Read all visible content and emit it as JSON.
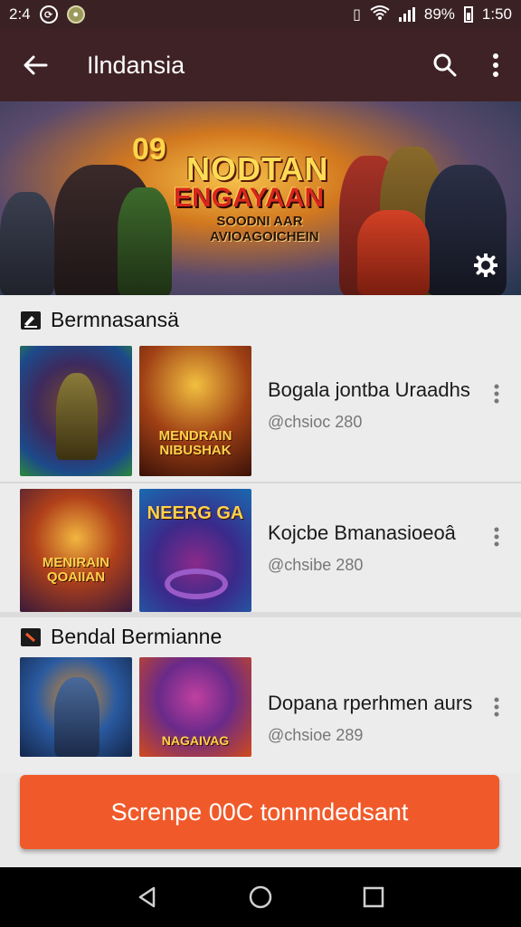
{
  "status": {
    "time_left": "2:4",
    "battery": "89%",
    "clock": "1:50"
  },
  "appbar": {
    "title": "Ilndansia"
  },
  "banner": {
    "number": "09",
    "logo_line1": "NODTAN",
    "logo_line2": "ENGAYAAN",
    "logo_line3": "SOODNI AAR AVIOAGOICHEIN"
  },
  "section1": {
    "title": "Bermnasansä"
  },
  "items1": [
    {
      "name": "Bogala jontba Uraadhs",
      "meta": "@chsioc 280",
      "thumb_text2": "MENDRAIN NIBUSHAK"
    },
    {
      "name": "Kojcbe Bmanasioeoâ",
      "meta": "@chsibe 280",
      "thumb_text1": "MENIRAIN QOAIIAN",
      "thumb_text2": "NEERG GA"
    }
  ],
  "section2": {
    "title": "Bendal Bermianne"
  },
  "items2": [
    {
      "name": "Dopana rperhmen aurs",
      "meta": "@chsioe 289",
      "thumb_text2": "NAGAIVAG"
    }
  ],
  "cta": {
    "label": "Screnpe 00C tonnndedsant"
  }
}
